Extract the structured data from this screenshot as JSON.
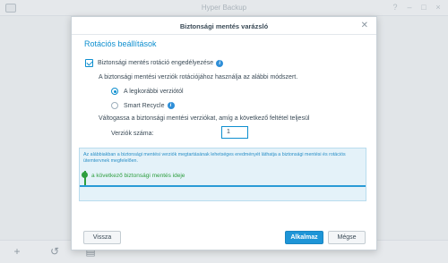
{
  "app": {
    "title": "Hyper Backup"
  },
  "dialog": {
    "title": "Biztonsági mentés varázsló",
    "section_title": "Rotációs beállítások",
    "enable_rotation_label": "Biztonsági mentés rotáció engedélyezése",
    "rotation_method_desc": "A biztonsági mentési verziók rotációjához használja az alábbi módszert.",
    "options": [
      {
        "label": "A legkorábbi verziótól",
        "selected": true
      },
      {
        "label": "Smart Recycle",
        "selected": false
      }
    ],
    "condition_desc": "Váltogassa a biztonsági mentési verziókat, amíg a következő feltétel teljesül",
    "version_count_label": "Verziók száma:",
    "version_count_value": "1",
    "timeline": {
      "description": "Az alábbiakban a biztonsági mentési verziók megtartásának lehetséges eredményét láthatja a biztonsági mentési és rotációs ütemtervnek megfelelően.",
      "marker_label": "a következő biztonsági mentés ideje"
    },
    "buttons": {
      "back": "Vissza",
      "apply": "Alkalmaz",
      "cancel": "Mégse"
    }
  },
  "colors": {
    "accent": "#0e8fcf",
    "primary_button": "#1e95d7",
    "timeline_marker": "#2e9e3f"
  },
  "icons": {
    "bottom_bar": [
      "plus-icon",
      "history-icon",
      "log-icon"
    ]
  }
}
